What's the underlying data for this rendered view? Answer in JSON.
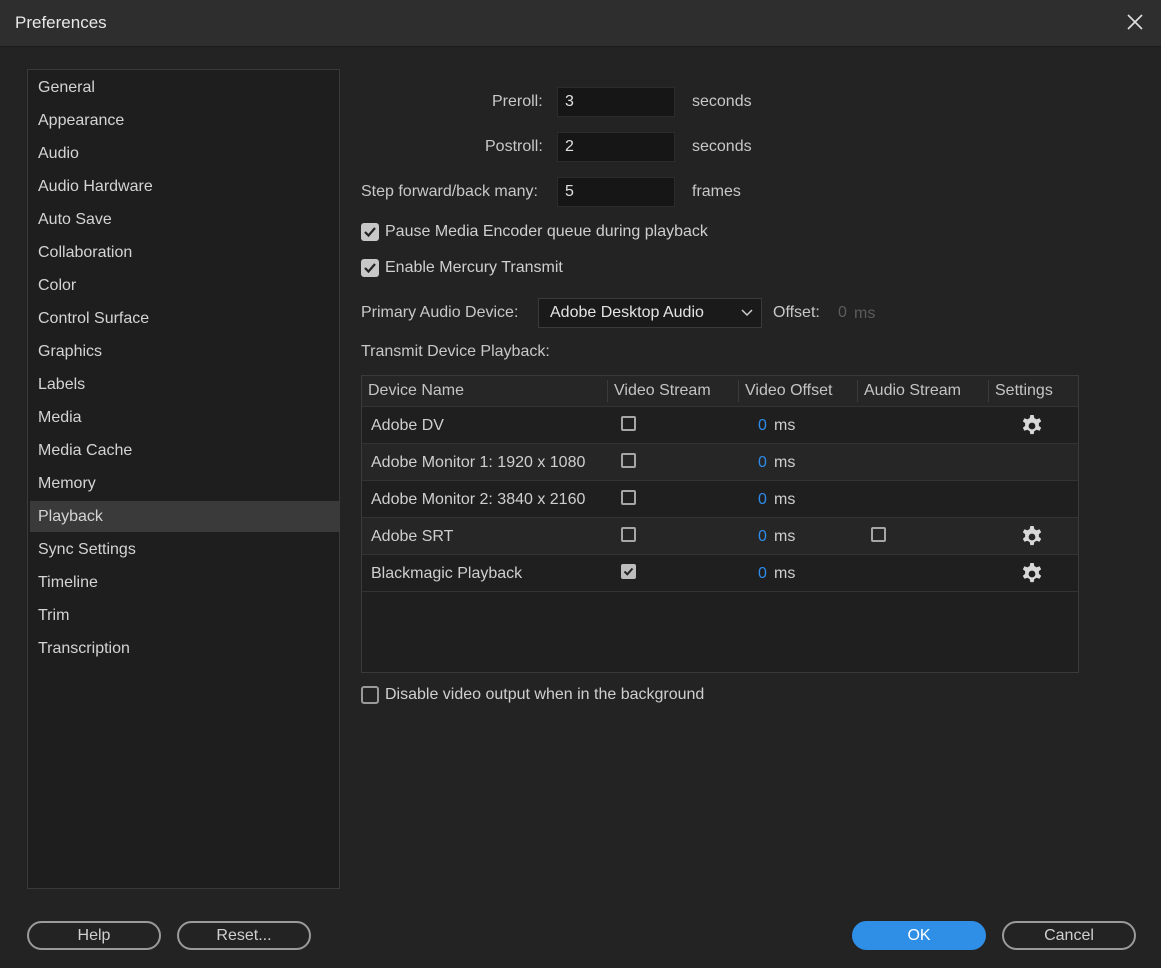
{
  "window": {
    "title": "Preferences"
  },
  "sidebar": {
    "items": [
      {
        "label": "General"
      },
      {
        "label": "Appearance"
      },
      {
        "label": "Audio"
      },
      {
        "label": "Audio Hardware"
      },
      {
        "label": "Auto Save"
      },
      {
        "label": "Collaboration"
      },
      {
        "label": "Color"
      },
      {
        "label": "Control Surface"
      },
      {
        "label": "Graphics"
      },
      {
        "label": "Labels"
      },
      {
        "label": "Media"
      },
      {
        "label": "Media Cache"
      },
      {
        "label": "Memory"
      },
      {
        "label": "Playback"
      },
      {
        "label": "Sync Settings"
      },
      {
        "label": "Timeline"
      },
      {
        "label": "Trim"
      },
      {
        "label": "Transcription"
      }
    ],
    "selected": "Playback"
  },
  "playback": {
    "preroll": {
      "label": "Preroll:",
      "value": "3",
      "unit": "seconds"
    },
    "postroll": {
      "label": "Postroll:",
      "value": "2",
      "unit": "seconds"
    },
    "step": {
      "label": "Step forward/back many:",
      "value": "5",
      "unit": "frames"
    },
    "pause_encoder": {
      "label": "Pause Media Encoder queue during playback",
      "checked": true
    },
    "mercury": {
      "label": "Enable Mercury Transmit",
      "checked": true
    },
    "audio_device": {
      "label": "Primary Audio Device:",
      "value": "Adobe Desktop Audio"
    },
    "offset": {
      "label": "Offset:",
      "value": "0",
      "unit": "ms"
    },
    "transmit_label": "Transmit Device Playback:",
    "disable_bg": {
      "label": "Disable video output when in the background",
      "checked": false
    }
  },
  "table": {
    "headers": [
      "Device Name",
      "Video Stream",
      "Video Offset",
      "Audio Stream",
      "Settings"
    ],
    "rows": [
      {
        "name": "Adobe DV",
        "video": false,
        "offset": "0",
        "unit": "ms",
        "audio": null,
        "settings": true
      },
      {
        "name": "Adobe Monitor 1: 1920 x 1080",
        "video": false,
        "offset": "0",
        "unit": "ms",
        "audio": null,
        "settings": false
      },
      {
        "name": "Adobe Monitor 2: 3840 x 2160",
        "video": false,
        "offset": "0",
        "unit": "ms",
        "audio": null,
        "settings": false
      },
      {
        "name": "Adobe SRT",
        "video": false,
        "offset": "0",
        "unit": "ms",
        "audio": false,
        "settings": true
      },
      {
        "name": "Blackmagic Playback",
        "video": true,
        "offset": "0",
        "unit": "ms",
        "audio": null,
        "settings": true
      }
    ]
  },
  "buttons": {
    "help": "Help",
    "reset": "Reset...",
    "ok": "OK",
    "cancel": "Cancel"
  },
  "colors": {
    "accent": "#2f8ee6",
    "offset_value": "#2d8ceb",
    "background": "#232323"
  }
}
